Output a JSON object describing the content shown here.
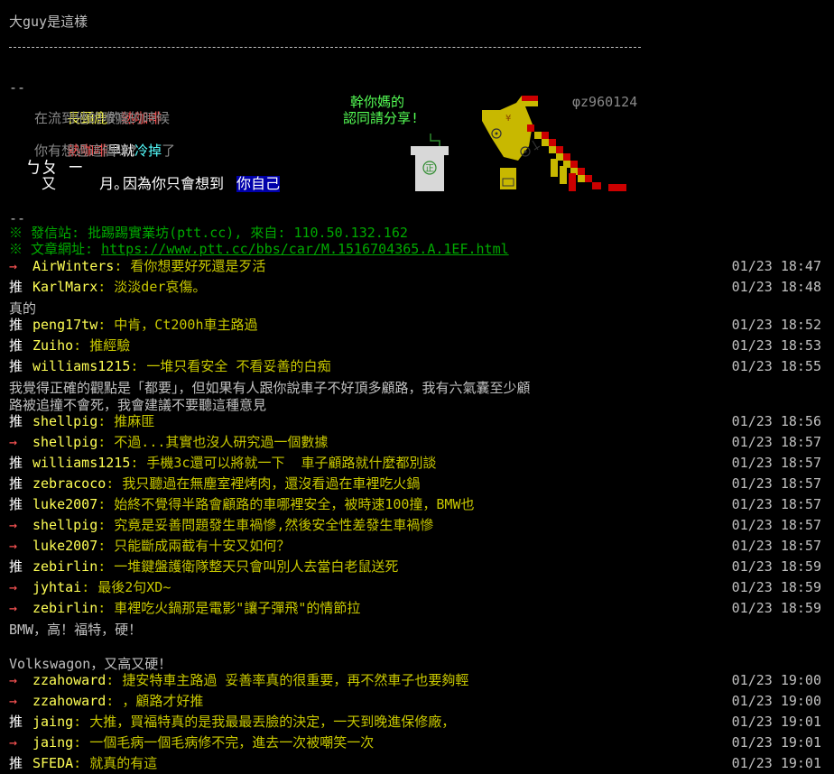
{
  "title": "大guy是這樣",
  "divider": "--",
  "signature": {
    "l1a": "長頸鹿",
    "l1b": "的",
    "l1c": "熱咖啡",
    "l2": "在流到他的喉嚨的時候",
    "l3a": "熱咖啡",
    "l3b": "早就",
    "l3c": "冷掉",
    "l3d": "了",
    "l4": "你有想過這個咪?",
    "l5a": "ㄅㄆ ㄧ",
    "l5b": "又     月。",
    "l5c": "因為你只會想到",
    "l5d": "你自己",
    "r1": "幹你媽的",
    "r2": "認同請分享!",
    "author": "φz960124",
    "cup_mark": "正"
  },
  "footer": {
    "dash": "--",
    "origin": "※ 發信站: 批踢踢實業坊(ptt.cc), 來自: 110.50.132.162",
    "url_label": "※ 文章網址: ",
    "url": "https://www.ptt.cc/bbs/car/M.1516704365.A.1EF.html"
  },
  "pushes": [
    {
      "tag": "→ ",
      "user": "AirWinters",
      "msg": ": 看你想要好死還是歹活",
      "time": "01/23 18:47"
    },
    {
      "tag": "推 ",
      "user": "KarlMarx",
      "msg": ": 淡淡der哀傷。",
      "time": "01/23 18:48"
    },
    {
      "cont": "真的"
    },
    {
      "tag": "推 ",
      "user": "peng17tw",
      "msg": ": 中肯，Ct200h車主路過",
      "time": "01/23 18:52"
    },
    {
      "tag": "推 ",
      "user": "Zuiho",
      "msg": ": 推經驗",
      "time": "01/23 18:53"
    },
    {
      "tag": "推 ",
      "user": "williams1215",
      "msg": ": 一堆只看安全 不看妥善的白痴",
      "time": "01/23 18:55"
    },
    {
      "cont": "我覺得正確的觀點是「都要」，但如果有人跟你說車子不好頂多顧路，我有六氣囊至少顧"
    },
    {
      "cont": "路被追撞不會死，我會建議不要聽這種意見"
    },
    {
      "tag": "推 ",
      "user": "shellpig",
      "msg": ": 推麻匪",
      "time": "01/23 18:56"
    },
    {
      "tag": "→ ",
      "user": "shellpig",
      "msg": ": 不過...其實也沒人研究過一個數據",
      "time": "01/23 18:57"
    },
    {
      "tag": "推 ",
      "user": "williams1215",
      "msg": ": 手機3c還可以將就一下  車子顧路就什麼都別談",
      "time": "01/23 18:57"
    },
    {
      "tag": "推 ",
      "user": "zebracoco",
      "msg": ": 我只聽過在無塵室裡烤肉，還沒看過在車裡吃火鍋",
      "time": "01/23 18:57"
    },
    {
      "tag": "推 ",
      "user": "luke2007",
      "msg": ": 始終不覺得半路會顧路的車哪裡安全，被時速100撞，BMW也",
      "time": "01/23 18:57"
    },
    {
      "tag": "→ ",
      "user": "shellpig",
      "msg": ": 究竟是妥善問題發生車禍慘,然後安全性差發生車禍慘",
      "time": "01/23 18:57"
    },
    {
      "tag": "→ ",
      "user": "luke2007",
      "msg": ": 只能斷成兩截有十安又如何？",
      "time": "01/23 18:57"
    },
    {
      "tag": "推 ",
      "user": "zebirlin",
      "msg": ": 一堆鍵盤護衛隊整天只會叫別人去當白老鼠送死",
      "time": "01/23 18:59"
    },
    {
      "tag": "→ ",
      "user": "jyhtai",
      "msg": ": 最後2句XD~",
      "time": "01/23 18:59"
    },
    {
      "tag": "→ ",
      "user": "zebirlin",
      "msg": ": 車裡吃火鍋那是電影\"讓子彈飛\"的情節拉",
      "time": "01/23 18:59"
    },
    {
      "cont": "BMW，高！福特，硬！"
    },
    {
      "cont": ""
    },
    {
      "cont": "Volkswagon，又高又硬！"
    },
    {
      "tag": "→ ",
      "user": "zzahoward",
      "msg": ": 捷安特車主路過 妥善率真的很重要，再不然車子也要夠輕",
      "time": "01/23 19:00"
    },
    {
      "tag": "→ ",
      "user": "zzahoward",
      "msg": ": ，顧路才好推",
      "time": "01/23 19:00"
    },
    {
      "tag": "推 ",
      "user": "jaing",
      "msg": ": 大推，買福特真的是我最最丟臉的決定，一天到晚進保修廠，",
      "time": "01/23 19:01"
    },
    {
      "tag": "→ ",
      "user": "jaing",
      "msg": ": 一個毛病一個毛病修不完，進去一次被嘲笑一次",
      "time": "01/23 19:01"
    },
    {
      "tag": "推 ",
      "user": "SFEDA",
      "msg": ": 就真的有這",
      "time": "01/23 19:01"
    }
  ]
}
